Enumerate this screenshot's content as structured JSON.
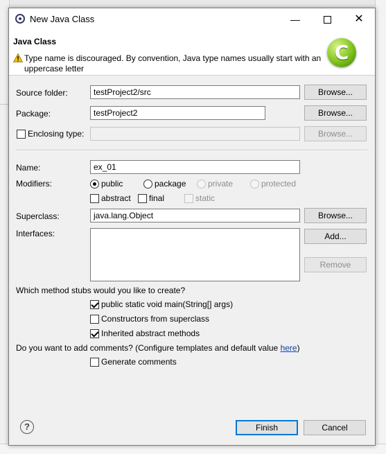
{
  "window": {
    "title": "New Java Class"
  },
  "banner": {
    "title": "Java Class",
    "message": "Type name is discouraged. By convention, Java type names usually start with an uppercase letter",
    "logo_letter": "C"
  },
  "source_folder": {
    "label": "Source folder:",
    "value": "testProject2/src",
    "browse": "Browse..."
  },
  "package": {
    "label": "Package:",
    "value": "testProject2",
    "browse": "Browse..."
  },
  "enclosing": {
    "label": "Enclosing type:",
    "value": "",
    "browse": "Browse..."
  },
  "name": {
    "label": "Name:",
    "value": "ex_01"
  },
  "modifiers": {
    "label": "Modifiers:",
    "public": "public",
    "package": "package",
    "private": "private",
    "protected": "protected",
    "abstract": "abstract",
    "final": "final",
    "static": "static"
  },
  "superclass": {
    "label": "Superclass:",
    "value": "java.lang.Object",
    "browse": "Browse..."
  },
  "interfaces": {
    "label": "Interfaces:",
    "add": "Add...",
    "remove": "Remove"
  },
  "stubs": {
    "question": "Which method stubs would you like to create?",
    "main": "public static void main(String[] args)",
    "constructors": "Constructors from superclass",
    "inherited": "Inherited abstract methods"
  },
  "comments": {
    "question_prefix": "Do you want to add comments? (Configure templates and default value ",
    "link": "here",
    "question_suffix": ")",
    "generate": "Generate comments"
  },
  "footer": {
    "finish": "Finish",
    "cancel": "Cancel",
    "help": "?"
  },
  "colors": {
    "accent": "#0078d7",
    "link": "#0645ad",
    "logo_green": "#7ec21b"
  }
}
